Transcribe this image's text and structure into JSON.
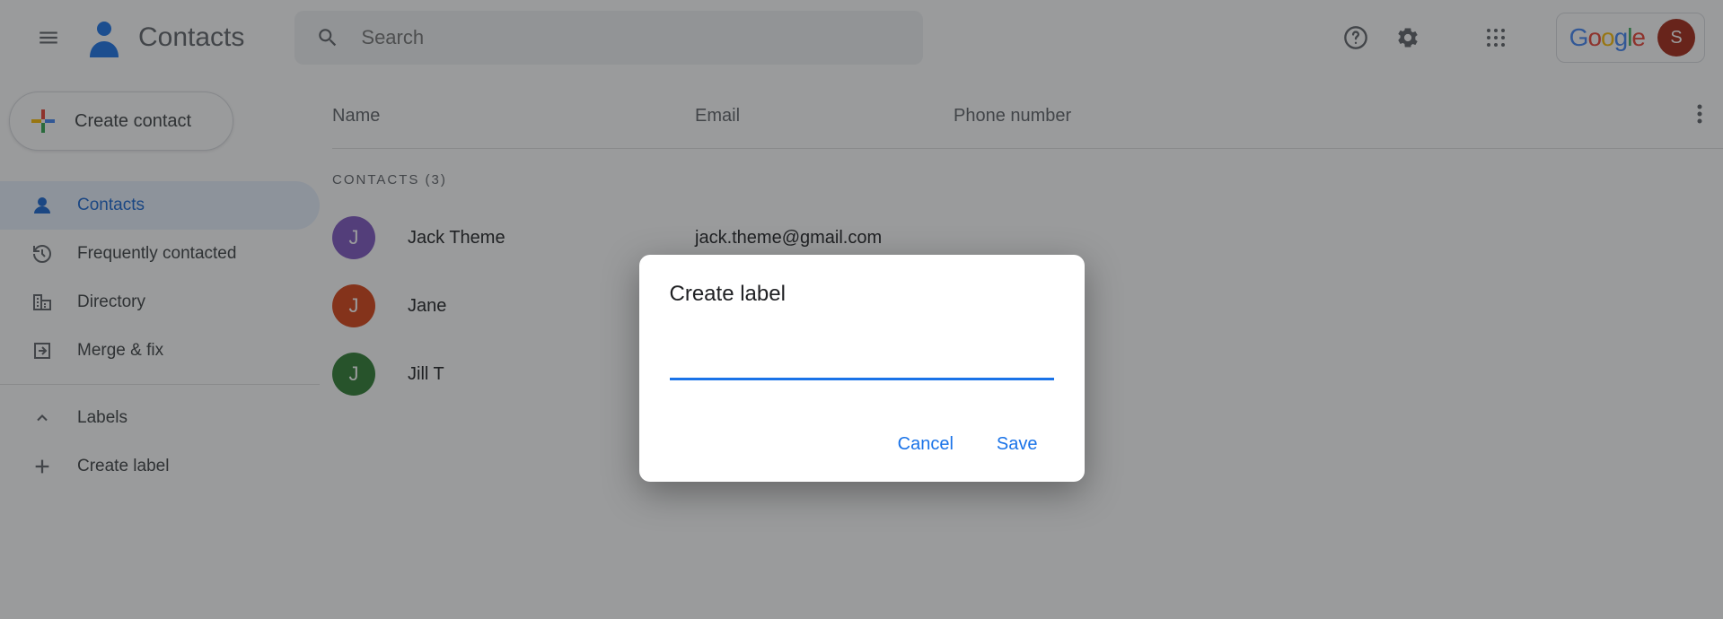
{
  "header": {
    "app_title": "Contacts",
    "search_placeholder": "Search",
    "google_logo": "Google",
    "account_initial": "S"
  },
  "sidebar": {
    "create_label": "Create contact",
    "items": [
      {
        "label": "Contacts",
        "icon": "person-icon",
        "active": true
      },
      {
        "label": "Frequently contacted",
        "icon": "history-icon",
        "active": false
      },
      {
        "label": "Directory",
        "icon": "domain-icon",
        "active": false
      },
      {
        "label": "Merge & fix",
        "icon": "merge-icon",
        "active": false
      }
    ],
    "labels_header": "Labels",
    "create_label_text": "Create label"
  },
  "main": {
    "columns": {
      "name": "Name",
      "email": "Email",
      "phone": "Phone number"
    },
    "section_label": "CONTACTS (3)",
    "contacts": [
      {
        "initial": "J",
        "color": "#7e57c2",
        "name": "Jack Theme",
        "email": "jack.theme@gmail.com"
      },
      {
        "initial": "J",
        "color": "#d84315",
        "name": "Jane",
        "email": ""
      },
      {
        "initial": "J",
        "color": "#2e7d32",
        "name": "Jill T",
        "email": ""
      }
    ]
  },
  "dialog": {
    "title": "Create label",
    "input_value": "",
    "cancel": "Cancel",
    "save": "Save"
  }
}
